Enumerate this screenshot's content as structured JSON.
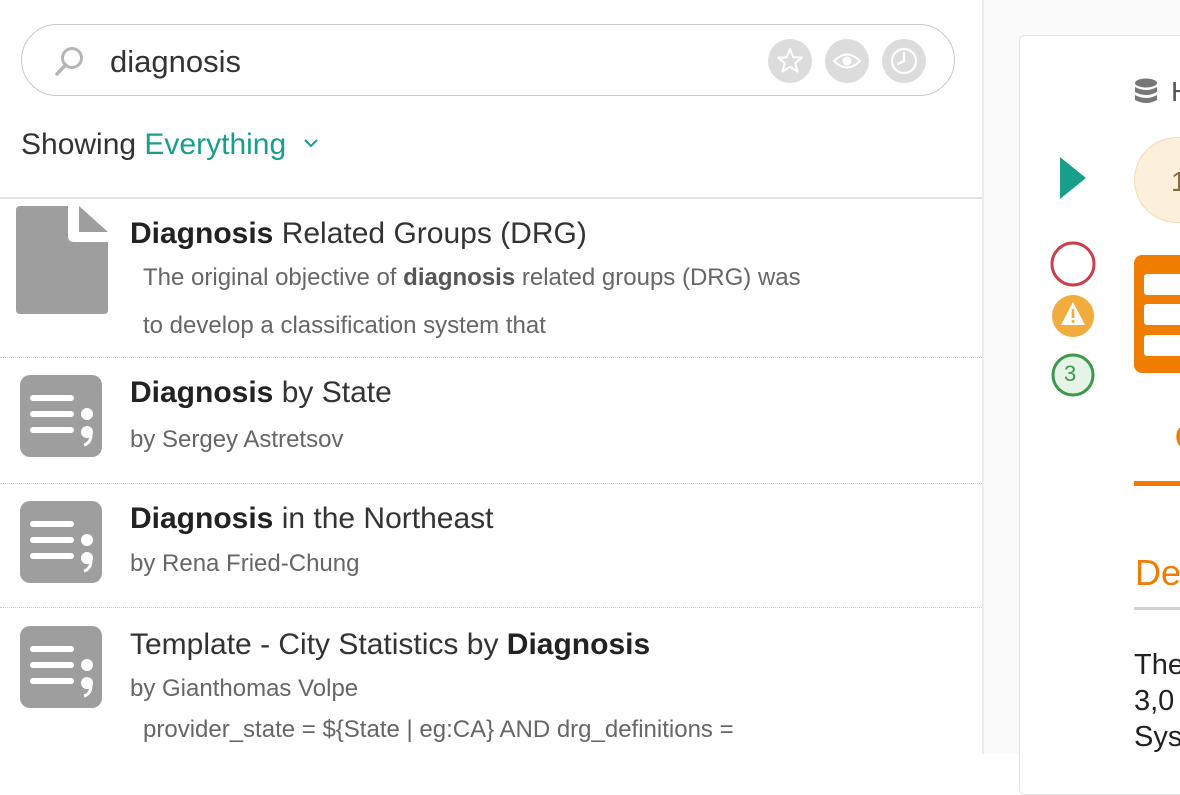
{
  "search": {
    "query": "diagnosis"
  },
  "toolbar": {
    "icons": [
      "star-icon",
      "eye-icon",
      "clock-icon"
    ]
  },
  "filter": {
    "label": "Showing",
    "value": "Everything"
  },
  "results": [
    {
      "type": "document",
      "title_bold": "Diagnosis",
      "title_rest": " Related Groups (DRG)",
      "desc_line1_pre": "The original objective of ",
      "desc_line1_bold": "diagnosis",
      "desc_line1_post": " related groups (DRG) was",
      "desc_line2": "to develop a classification system that"
    },
    {
      "type": "query",
      "title_bold": "Diagnosis",
      "title_rest": " by State",
      "author": "by Sergey Astretsov"
    },
    {
      "type": "query",
      "title_bold": "Diagnosis",
      "title_rest": " in the Northeast",
      "author": "by Rena Fried-Chung"
    },
    {
      "type": "query",
      "title_pre": "Template - City Statistics by ",
      "title_bold": "Diagnosis",
      "author": "by Gianthomas Volpe",
      "desc": "provider_state = ${State | eg:CA} AND drg_definitions ="
    }
  ],
  "detail": {
    "header_fragment": "H",
    "badge_fragment": "1",
    "status_count": "3",
    "tab_fragment": "C",
    "heading_fragment": "De",
    "body_fragments": [
      "The",
      "3,0",
      "Sys"
    ],
    "colors": {
      "accent_orange": "#f07d00",
      "teal": "#1a9e8c",
      "warning": "#f0ac3c",
      "error": "#c8404a",
      "ok": "#3a9a4a"
    }
  }
}
